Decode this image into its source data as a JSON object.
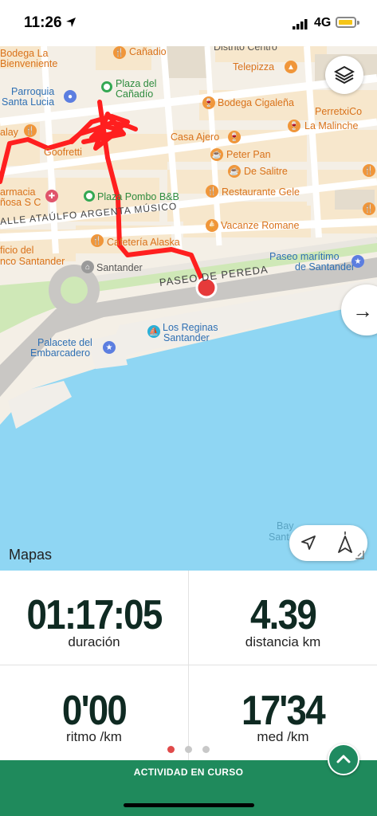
{
  "status_bar": {
    "time": "11:26",
    "network": "4G"
  },
  "map": {
    "labels": {
      "bodega": "Bodega La",
      "bienveniente": "Bienveniente",
      "canadio": "Cañadio",
      "distrito": "Distrito Centro",
      "telepizza": "Telepizza",
      "parroquia": "Parroquia",
      "santa_lucia": "Santa Lucia",
      "plaza1": "Plaza del",
      "plaza2": "Cañadío",
      "bodega_cig": "Bodega Cigaleña",
      "perretxico": "PerretxiCo",
      "malinche": "La Malinche",
      "alay": "alay",
      "goofretti": "Goofretti",
      "casa_ajero": "Casa Ajero",
      "peter_pan": "Peter Pan",
      "de_salitre": "De Salitre",
      "farmacia1": "armacia",
      "farmacia2": "ñosa S C",
      "plaza_pombo": "Plaza Pombo B&B",
      "rest_gele": "Restaurante Gele",
      "calle": "ALLE ATAÚLFO ARGENTA MÚSICO",
      "vacanze": "Vacanze Romane",
      "alaska": "Cafetería Alaska",
      "oficio1": "ficio del",
      "oficio2": "nco Santander",
      "santander": "Santander",
      "paseo_maritimo1": "Paseo marítimo",
      "paseo_maritimo2": "de Santander",
      "paseo_pereda": "PASEO DE PEREDA",
      "reginas1": "Los Reginas",
      "reginas2": "Santander",
      "palacete1": "Palacete del",
      "palacete2": "Embarcadero",
      "bay1": "Bay",
      "bay2": "Sant"
    },
    "attribution": "Mapas",
    "colors": {
      "route": "#ff1f1f",
      "water": "#8fd6f3",
      "park": "#cfe8b7",
      "poi_orange": "#f0963a",
      "poi_green": "#34a853",
      "accent": "#1f8a5c"
    },
    "icons": {
      "layers": "layers-icon",
      "next": "arrow-right-icon",
      "location": "location-arrow-icon",
      "compass": "compass-icon"
    }
  },
  "stats": {
    "duration": {
      "value": "01:17:05",
      "label": "duración"
    },
    "distance": {
      "value": "4.39",
      "label": "distancia km"
    },
    "pace": {
      "value": "0'00",
      "label": "ritmo /km"
    },
    "avg": {
      "value": "17'34",
      "label": "med /km"
    }
  },
  "pager": {
    "active_color": "#e04a4a",
    "inactive_color": "#c8c8c8"
  },
  "footer": {
    "label": "ACTIVIDAD EN CURSO"
  }
}
